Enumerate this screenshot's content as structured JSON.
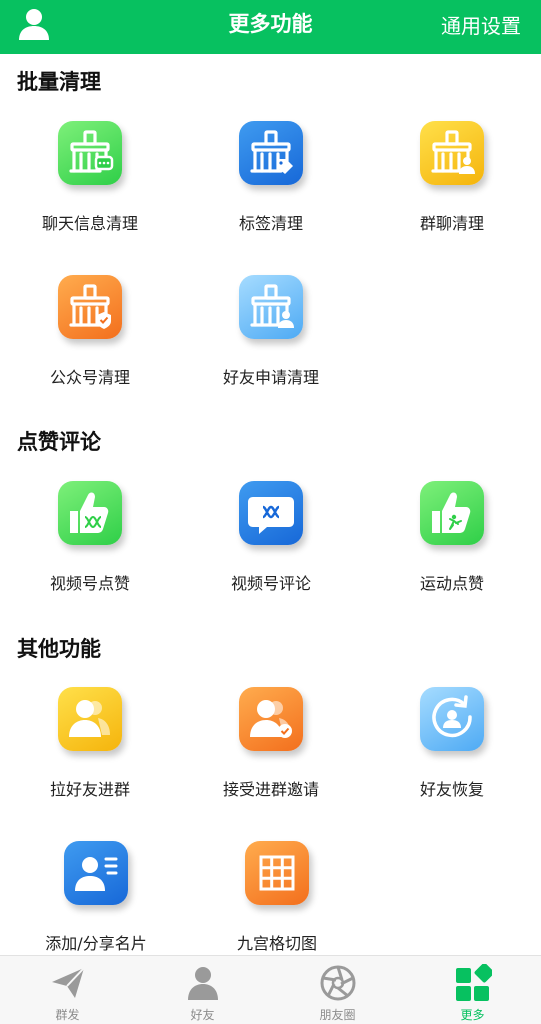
{
  "header": {
    "title": "更多功能",
    "settings_label": "通用设置"
  },
  "sections": [
    {
      "title": "批量清理"
    },
    {
      "title": "点赞评论"
    },
    {
      "title": "其他功能"
    }
  ],
  "items": [
    {
      "label": "聊天信息清理",
      "icon": "broom-chat-icon"
    },
    {
      "label": "标签清理",
      "icon": "broom-tag-icon"
    },
    {
      "label": "群聊清理",
      "icon": "broom-group-icon"
    },
    {
      "label": "公众号清理",
      "icon": "broom-official-account-icon"
    },
    {
      "label": "好友申请清理",
      "icon": "broom-friend-request-icon"
    },
    {
      "label": "视频号点赞",
      "icon": "thumbs-up-channels-icon"
    },
    {
      "label": "视频号评论",
      "icon": "comment-bubble-icon"
    },
    {
      "label": "运动点赞",
      "icon": "thumbs-up-sport-icon"
    },
    {
      "label": "拉好友进群",
      "icon": "add-friends-to-group-icon"
    },
    {
      "label": "接受进群邀请",
      "icon": "accept-group-invite-icon"
    },
    {
      "label": "好友恢复",
      "icon": "friend-restore-icon"
    },
    {
      "label": "添加/分享名片",
      "icon": "contact-card-icon"
    },
    {
      "label": "九宫格切图",
      "icon": "nine-grid-icon"
    }
  ],
  "tabs": [
    {
      "label": "群发",
      "icon": "paper-plane-icon"
    },
    {
      "label": "好友",
      "icon": "person-icon"
    },
    {
      "label": "朋友圈",
      "icon": "aperture-icon"
    },
    {
      "label": "更多",
      "icon": "more-grid-icon"
    }
  ],
  "colors": {
    "brand": "#07c160",
    "tab_inactive": "#8c8c8c",
    "tile_green": "#2fcf48",
    "tile_blue": "#1768d8",
    "tile_yellow": "#f5b40c",
    "tile_orange": "#f36f1d",
    "tile_sky": "#4eaaf4"
  }
}
